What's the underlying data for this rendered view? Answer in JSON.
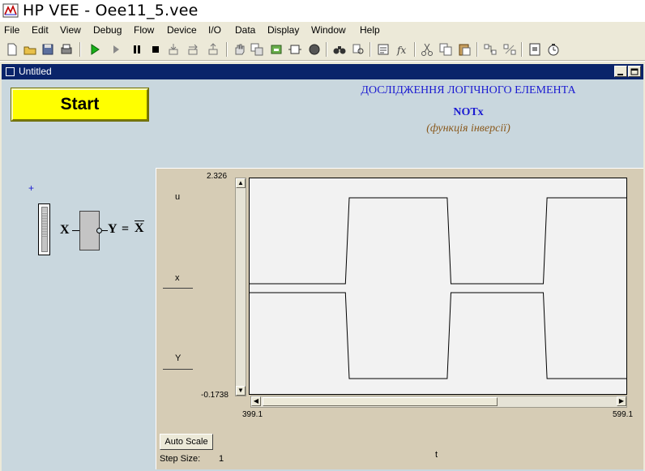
{
  "app": {
    "title": "HP VEE - Oee11_5.vee"
  },
  "menu": {
    "items": [
      "File",
      "Edit",
      "View",
      "Debug",
      "Flow",
      "Device",
      "I/O",
      "Data",
      "Display",
      "Window",
      "Help"
    ]
  },
  "toolbar": {
    "icons": [
      "new-icon",
      "open-icon",
      "save-icon",
      "print-icon",
      "run-icon",
      "step-icon",
      "pause-icon",
      "stop-icon",
      "step-into-icon",
      "step-over-icon",
      "step-out-icon",
      "hand-icon",
      "clone-icon",
      "group-icon",
      "object-icon",
      "breakpoint-icon",
      "find-icon",
      "zoom-find-icon",
      "properties-icon",
      "function-icon",
      "cut-icon",
      "copy-icon",
      "paste-icon",
      "connect-icon",
      "disconnect-icon",
      "panel-view-icon",
      "timer-icon"
    ]
  },
  "workspace": {
    "title": "Untitled"
  },
  "panel": {
    "start_label": "Start",
    "heading_line1": "ДОСЛІДЖЕННЯ ЛОГІЧНОГО ЕЛЕМЕНТА",
    "heading_line2": "NOTx",
    "heading_line3": "(функція інверсії)",
    "plus_marker": "+",
    "toggle_value": 1,
    "gate": {
      "input_label": "X",
      "output_label": "Y",
      "equals": "=",
      "output_expr": "X"
    }
  },
  "strip_chart": {
    "ymax_label": "2.326",
    "ymin_label": "-0.1738",
    "xmin_label": "399.1",
    "xmax_label": "599.1",
    "xaxis_label": "t",
    "traces": [
      "u",
      "x",
      "Y"
    ],
    "autoscale_label": "Auto Scale",
    "step_size_label": "Step Size:",
    "step_size_value": "1"
  },
  "chart_data": {
    "type": "line",
    "x": [
      399.1,
      599.1
    ],
    "xlim": [
      399.1,
      599.1
    ],
    "series": [
      {
        "name": "x",
        "points": [
          [
            399.1,
            0
          ],
          [
            450,
            0
          ],
          [
            452,
            1
          ],
          [
            504,
            1
          ],
          [
            506,
            0
          ],
          [
            555,
            0
          ],
          [
            557,
            1
          ],
          [
            599.1,
            1
          ]
        ]
      },
      {
        "name": "Y",
        "points": [
          [
            399.1,
            1
          ],
          [
            450,
            1
          ],
          [
            452,
            0
          ],
          [
            504,
            0
          ],
          [
            506,
            1
          ],
          [
            555,
            1
          ],
          [
            557,
            0
          ],
          [
            599.1,
            0
          ]
        ]
      }
    ]
  }
}
